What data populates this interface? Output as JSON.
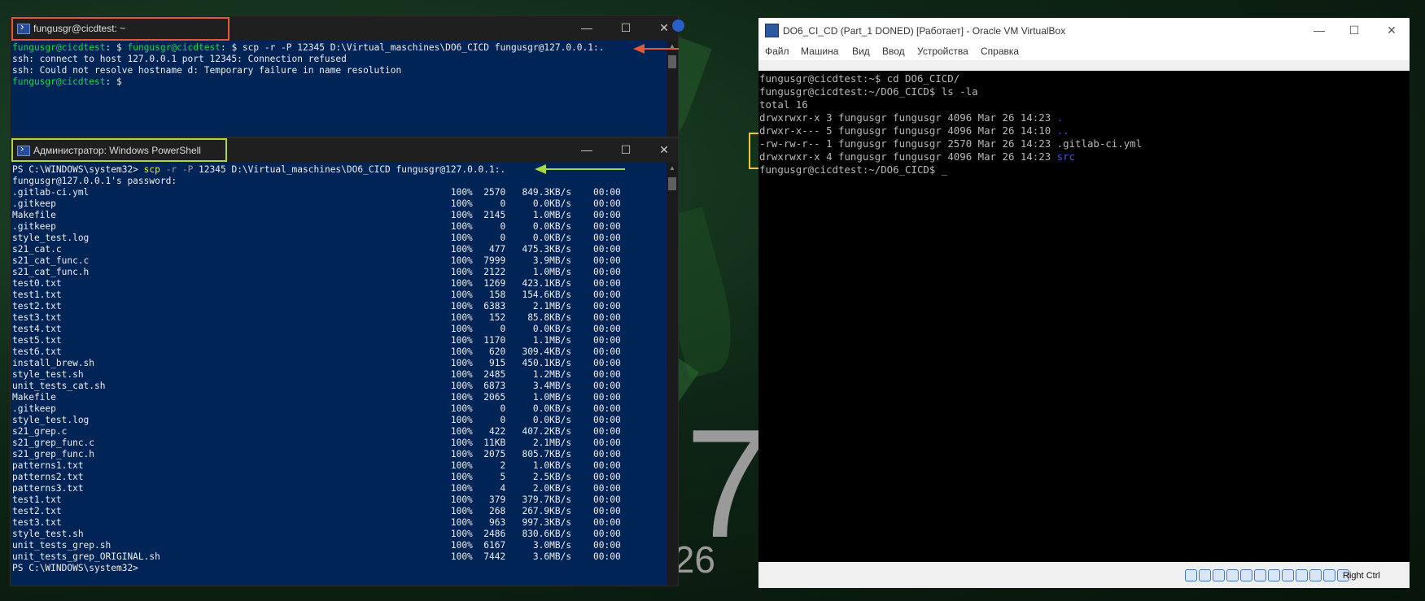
{
  "desktop": {
    "clock_digit": "7",
    "clock_date_fragment": ".26"
  },
  "window1": {
    "title": "fungusgr@cicdtest: ~",
    "lines": [
      {
        "prompt_user": "fungusgr@cicdtest",
        "prompt_tail": ": $ ",
        "prompt_user2": "fungusgr@cicdtest",
        "cmd": ": $ scp -r -P 12345 D:\\Virtual_maschines\\DO6_CICD fungusgr@127.0.0.1:."
      },
      {
        "text": "ssh: connect to host 127.0.0.1 port 12345: Connection refused"
      },
      {
        "text": "ssh: Could not resolve hostname d: Temporary failure in name resolution"
      },
      {
        "prompt_user": "fungusgr@cicdtest",
        "prompt_tail": ": $"
      }
    ]
  },
  "window2": {
    "title": "Администратор: Windows PowerShell",
    "prompt": "PS C:\\WINDOWS\\system32> ",
    "cmd_scp": "scp",
    "cmd_flag_r": " -r ",
    "cmd_flag_p": "-P",
    "cmd_args": " 12345 D:\\Virtual_maschines\\DO6_CICD fungusgr@127.0.0.1:.",
    "password_line": "fungusgr@127.0.0.1's password:",
    "files": [
      {
        "name": ".gitlab-ci.yml",
        "pct": "100%",
        "size": "2570",
        "speed": "849.3KB/s",
        "time": "00:00"
      },
      {
        "name": ".gitkeep",
        "pct": "100%",
        "size": "0",
        "speed": "0.0KB/s",
        "time": "00:00"
      },
      {
        "name": "Makefile",
        "pct": "100%",
        "size": "2145",
        "speed": "1.0MB/s",
        "time": "00:00"
      },
      {
        "name": ".gitkeep",
        "pct": "100%",
        "size": "0",
        "speed": "0.0KB/s",
        "time": "00:00"
      },
      {
        "name": "style_test.log",
        "pct": "100%",
        "size": "0",
        "speed": "0.0KB/s",
        "time": "00:00"
      },
      {
        "name": "s21_cat.c",
        "pct": "100%",
        "size": "477",
        "speed": "475.3KB/s",
        "time": "00:00"
      },
      {
        "name": "s21_cat_func.c",
        "pct": "100%",
        "size": "7999",
        "speed": "3.9MB/s",
        "time": "00:00"
      },
      {
        "name": "s21_cat_func.h",
        "pct": "100%",
        "size": "2122",
        "speed": "1.0MB/s",
        "time": "00:00"
      },
      {
        "name": "test0.txt",
        "pct": "100%",
        "size": "1269",
        "speed": "423.1KB/s",
        "time": "00:00"
      },
      {
        "name": "test1.txt",
        "pct": "100%",
        "size": "158",
        "speed": "154.6KB/s",
        "time": "00:00"
      },
      {
        "name": "test2.txt",
        "pct": "100%",
        "size": "6383",
        "speed": "2.1MB/s",
        "time": "00:00"
      },
      {
        "name": "test3.txt",
        "pct": "100%",
        "size": "152",
        "speed": "85.8KB/s",
        "time": "00:00"
      },
      {
        "name": "test4.txt",
        "pct": "100%",
        "size": "0",
        "speed": "0.0KB/s",
        "time": "00:00"
      },
      {
        "name": "test5.txt",
        "pct": "100%",
        "size": "1170",
        "speed": "1.1MB/s",
        "time": "00:00"
      },
      {
        "name": "test6.txt",
        "pct": "100%",
        "size": "620",
        "speed": "309.4KB/s",
        "time": "00:00"
      },
      {
        "name": "install_brew.sh",
        "pct": "100%",
        "size": "915",
        "speed": "450.1KB/s",
        "time": "00:00"
      },
      {
        "name": "style_test.sh",
        "pct": "100%",
        "size": "2485",
        "speed": "1.2MB/s",
        "time": "00:00"
      },
      {
        "name": "unit_tests_cat.sh",
        "pct": "100%",
        "size": "6873",
        "speed": "3.4MB/s",
        "time": "00:00"
      },
      {
        "name": "Makefile",
        "pct": "100%",
        "size": "2065",
        "speed": "1.0MB/s",
        "time": "00:00"
      },
      {
        "name": ".gitkeep",
        "pct": "100%",
        "size": "0",
        "speed": "0.0KB/s",
        "time": "00:00"
      },
      {
        "name": "style_test.log",
        "pct": "100%",
        "size": "0",
        "speed": "0.0KB/s",
        "time": "00:00"
      },
      {
        "name": "s21_grep.c",
        "pct": "100%",
        "size": "422",
        "speed": "407.2KB/s",
        "time": "00:00"
      },
      {
        "name": "s21_grep_func.c",
        "pct": "100%",
        "size": "11KB",
        "speed": "2.1MB/s",
        "time": "00:00"
      },
      {
        "name": "s21_grep_func.h",
        "pct": "100%",
        "size": "2075",
        "speed": "805.7KB/s",
        "time": "00:00"
      },
      {
        "name": "patterns1.txt",
        "pct": "100%",
        "size": "2",
        "speed": "1.0KB/s",
        "time": "00:00"
      },
      {
        "name": "patterns2.txt",
        "pct": "100%",
        "size": "5",
        "speed": "2.5KB/s",
        "time": "00:00"
      },
      {
        "name": "patterns3.txt",
        "pct": "100%",
        "size": "4",
        "speed": "2.0KB/s",
        "time": "00:00"
      },
      {
        "name": "test1.txt",
        "pct": "100%",
        "size": "379",
        "speed": "379.7KB/s",
        "time": "00:00"
      },
      {
        "name": "test2.txt",
        "pct": "100%",
        "size": "268",
        "speed": "267.9KB/s",
        "time": "00:00"
      },
      {
        "name": "test3.txt",
        "pct": "100%",
        "size": "963",
        "speed": "997.3KB/s",
        "time": "00:00"
      },
      {
        "name": "style_test.sh",
        "pct": "100%",
        "size": "2486",
        "speed": "830.6KB/s",
        "time": "00:00"
      },
      {
        "name": "unit_tests_grep.sh",
        "pct": "100%",
        "size": "6167",
        "speed": "3.0MB/s",
        "time": "00:00"
      },
      {
        "name": "unit_tests_grep_ORIGINAL.sh",
        "pct": "100%",
        "size": "7442",
        "speed": "3.6MB/s",
        "time": "00:00"
      }
    ],
    "final_prompt": "PS C:\\WINDOWS\\system32>"
  },
  "virtualbox": {
    "title": "DO6_CI_CD (Part_1 DONED) [Работает] - Oracle VM VirtualBox",
    "menu": [
      "Файл",
      "Машина",
      "Вид",
      "Ввод",
      "Устройства",
      "Справка"
    ],
    "lines": [
      "fungusgr@cicdtest:~$ cd DO6_CICD/",
      "fungusgr@cicdtest:~/DO6_CICD$ ls -la",
      "total 16"
    ],
    "ls_rows": [
      {
        "perm": "drwxrwxr-x",
        "n": "3",
        "user": "fungusgr",
        "group": "fungusgr",
        "size": "4096",
        "date": "Mar 26 14:23",
        "name": "."
      },
      {
        "perm": "drwxr-x---",
        "n": "5",
        "user": "fungusgr",
        "group": "fungusgr",
        "size": "4096",
        "date": "Mar 26 14:10",
        "name": ".."
      },
      {
        "perm": "-rw-rw-r--",
        "n": "1",
        "user": "fungusgr",
        "group": "fungusgr",
        "size": "2570",
        "date": "Mar 26 14:23",
        "name": ".gitlab-ci.yml"
      },
      {
        "perm": "drwxrwxr-x",
        "n": "4",
        "user": "fungusgr",
        "group": "fungusgr",
        "size": "4096",
        "date": "Mar 26 14:23",
        "name": "src"
      }
    ],
    "final_prompt": "fungusgr@cicdtest:~/DO6_CICD$ _",
    "host_key": "Right Ctrl"
  },
  "colors": {
    "ps_background": "#012456",
    "prompt_green": "#13d94a",
    "highlight_red": "#e05a3a",
    "highlight_green": "#a8d84a",
    "highlight_yellow": "#f2c83a",
    "dir_blue": "#3b5bd6"
  }
}
